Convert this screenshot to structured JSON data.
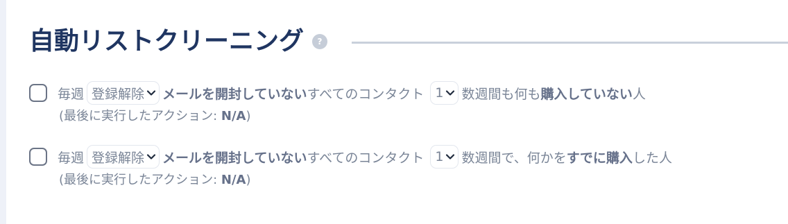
{
  "header": {
    "title": "自動リストクリーニング",
    "help_icon": "?"
  },
  "rules": [
    {
      "frequency": "毎週",
      "action_select": "登録解除",
      "condition_bold": "メールを開封していない",
      "contacts_text": "すべてのコンタクト",
      "weeks_select": "1",
      "suffix_text_1": "数週間も何も",
      "suffix_bold": "購入していない",
      "suffix_text_2": "人",
      "last_action_label": "(最後に実行したアクション: ",
      "last_action_value": "N/A",
      "last_action_close": ")"
    },
    {
      "frequency": "毎週",
      "action_select": "登録解除",
      "condition_bold": "メールを開封していない",
      "contacts_text": "すべてのコンタクト",
      "weeks_select": "1",
      "suffix_text_1": "数週間で、何かを",
      "suffix_bold": "すでに購入",
      "suffix_text_2": "した人",
      "last_action_label": "(最後に実行したアクション: ",
      "last_action_value": "N/A",
      "last_action_close": ")"
    }
  ]
}
